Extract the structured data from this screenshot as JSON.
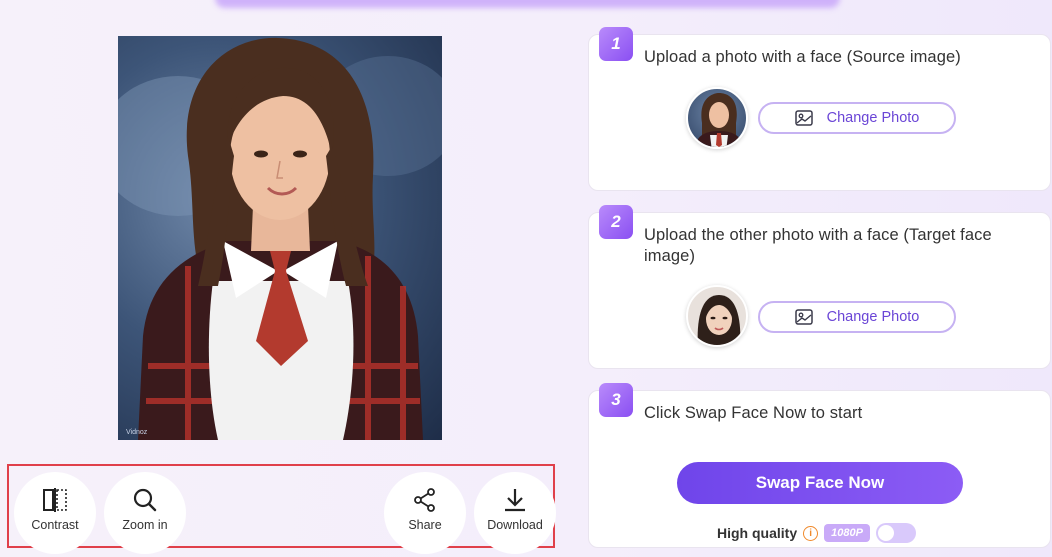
{
  "toolbar": {
    "contrast_label": "Contrast",
    "zoom_label": "Zoom in",
    "share_label": "Share",
    "download_label": "Download"
  },
  "photo": {
    "watermark": "Vidnoz"
  },
  "steps": [
    {
      "number": "1",
      "title": "Upload a photo with a face (Source image)",
      "button_label": "Change Photo"
    },
    {
      "number": "2",
      "title": "Upload the other photo with a face (Target face image)",
      "button_label": "Change Photo"
    },
    {
      "number": "3",
      "title": "Click Swap Face Now to start"
    }
  ],
  "swap": {
    "button_label": "Swap Face Now",
    "quality_label": "High quality",
    "quality_badge": "1080P",
    "toggle_on": false
  },
  "colors": {
    "accent": "#7a4ff0",
    "outline": "#c6b2f2",
    "highlight_box": "#e0404a"
  }
}
